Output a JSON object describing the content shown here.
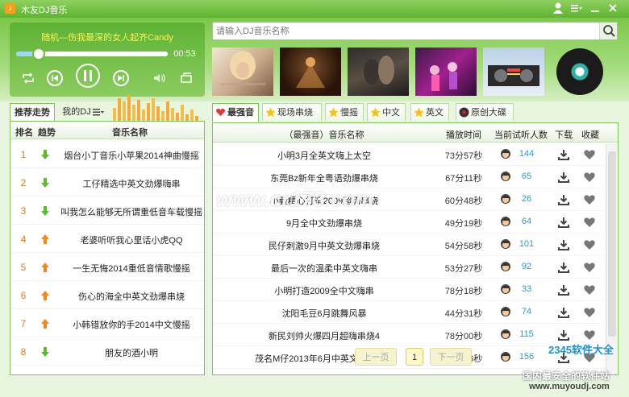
{
  "window": {
    "title": "木友DJ音乐"
  },
  "player": {
    "song_title": "随机—伤我最深的女人起齐Candy",
    "time": "00:53",
    "progress": 0.15
  },
  "search": {
    "placeholder": "请输入DJ音乐名称"
  },
  "left_tabs": [
    {
      "label": "推荐走势",
      "active": true
    },
    {
      "label": "我的DJ",
      "active": false
    }
  ],
  "left_list": {
    "headers": {
      "rank": "排名",
      "trend": "趋势",
      "name": "音乐名称"
    },
    "items": [
      {
        "rank": "1",
        "trend": "down",
        "name": "烟台小丁音乐小苹果2014神曲慢摇"
      },
      {
        "rank": "2",
        "trend": "down",
        "name": "工仔精选中英文劲爆嗨串"
      },
      {
        "rank": "3",
        "trend": "down",
        "name": "叫我怎么能够无所谓重低音车载慢摇"
      },
      {
        "rank": "4",
        "trend": "up",
        "name": "老婆听听我心里话小虎QQ"
      },
      {
        "rank": "5",
        "trend": "up",
        "name": "一生无悔2014重低音情歌慢摇"
      },
      {
        "rank": "6",
        "trend": "up",
        "name": "伤心的海全中英文劲爆串烧"
      },
      {
        "rank": "7",
        "trend": "up",
        "name": "小韩错放你的手2014中文慢摇"
      },
      {
        "rank": "8",
        "trend": "down",
        "name": "朋友的酒小明"
      }
    ]
  },
  "right_tabs": [
    {
      "label": "最强音",
      "icon": "heart-icon",
      "active": true
    },
    {
      "label": "现场串烧",
      "icon": "star-icon",
      "active": false
    },
    {
      "label": "慢摇",
      "icon": "star-icon",
      "active": false
    },
    {
      "label": "中文",
      "icon": "star-icon",
      "active": false
    },
    {
      "label": "英文",
      "icon": "star-icon",
      "active": false
    },
    {
      "label": "原创大碟",
      "icon": "disc-icon",
      "active": false
    }
  ],
  "right_list": {
    "headers": {
      "name": "（最强音）音乐名称",
      "duration": "播放时间",
      "listeners": "当前试听人数",
      "download": "下载",
      "favorite": "收藏"
    },
    "rows": [
      {
        "name": "小明3月全英文嗨上太空",
        "duration": "73分57秒",
        "listeners": "144"
      },
      {
        "name": "东莞Bz新年全粤语劲爆串烧",
        "duration": "67分11秒",
        "listeners": "65"
      },
      {
        "name": "小毅精心打造2009超嗨串烧",
        "duration": "60分48秒",
        "listeners": "26"
      },
      {
        "name": "9月全中文劲爆串烧",
        "duration": "49分19秒",
        "listeners": "64"
      },
      {
        "name": "民仔刺激9月中英文劲爆串烧",
        "duration": "54分58秒",
        "listeners": "101"
      },
      {
        "name": "最后一次的温柔中英文嗨串",
        "duration": "53分27秒",
        "listeners": "92"
      },
      {
        "name": "小明打造2009全中文嗨串",
        "duration": "78分18秒",
        "listeners": "33"
      },
      {
        "name": "沈阳毛豆6月跳舞风暴",
        "duration": "44分31秒",
        "listeners": "74"
      },
      {
        "name": "新民刘帅火爆四月超嗨串烧4",
        "duration": "78分00秒",
        "listeners": "115"
      },
      {
        "name": "茂名M仔2013年6月中英文劲爆串烧",
        "duration": "58分56秒",
        "listeners": "156"
      }
    ]
  },
  "pager": {
    "prev": "上一页",
    "current": "1",
    "next": "下一页"
  },
  "watermarks": {
    "center": "www.cr173.com",
    "site_name": "2345软件大全",
    "site_slogan": "国内最安全的软件站",
    "site_url": "www.muyoudj.com"
  },
  "colors": {
    "accent": "#6fbf3f",
    "rank": "#e67a17",
    "listeners": "#1a9fd6",
    "song_title": "#f7f45b"
  }
}
